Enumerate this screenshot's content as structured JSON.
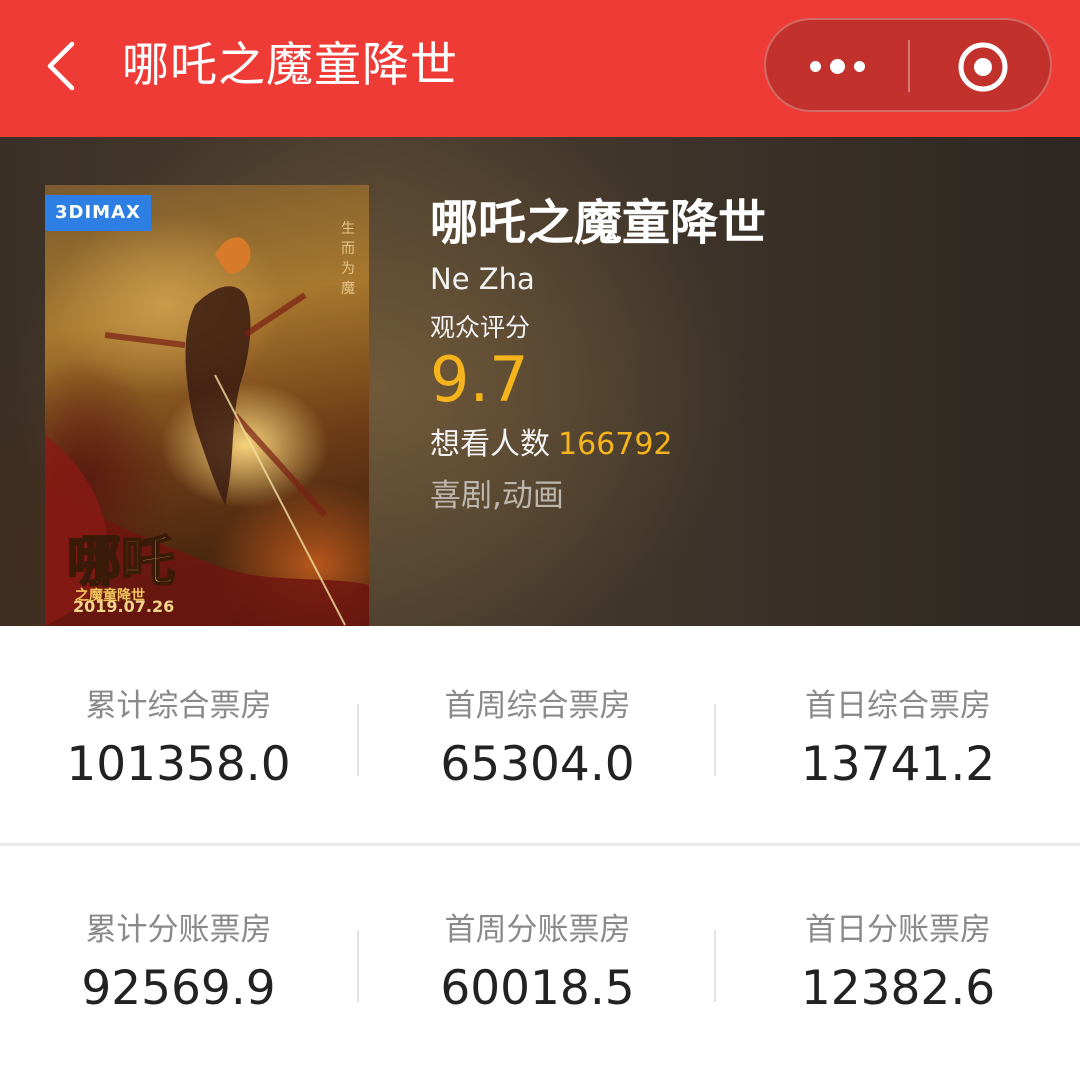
{
  "nav": {
    "title": "哪吒之魔童降世",
    "background": "#ee3b36",
    "back_icon": "chevron-left-icon",
    "more_icon": "more-dots-icon",
    "close_icon": "target-close-icon"
  },
  "movie": {
    "badge": "3DIMAX",
    "poster_date": "2019.07.26",
    "poster_side_text": "生而为魔",
    "title": "哪吒之魔童降世",
    "english_title": "Ne Zha",
    "rating_label": "观众评分",
    "rating": "9.7",
    "want_label": "想看人数",
    "want_count": "166792",
    "genres": "喜剧,动画",
    "accent_color": "#f5b31c"
  },
  "box_office": {
    "rows": [
      [
        {
          "label": "累计综合票房",
          "value": "101358.0"
        },
        {
          "label": "首周综合票房",
          "value": "65304.0"
        },
        {
          "label": "首日综合票房",
          "value": "13741.2"
        }
      ],
      [
        {
          "label": "累计分账票房",
          "value": "92569.9"
        },
        {
          "label": "首周分账票房",
          "value": "60018.5"
        },
        {
          "label": "首日分账票房",
          "value": "12382.6"
        }
      ]
    ]
  }
}
